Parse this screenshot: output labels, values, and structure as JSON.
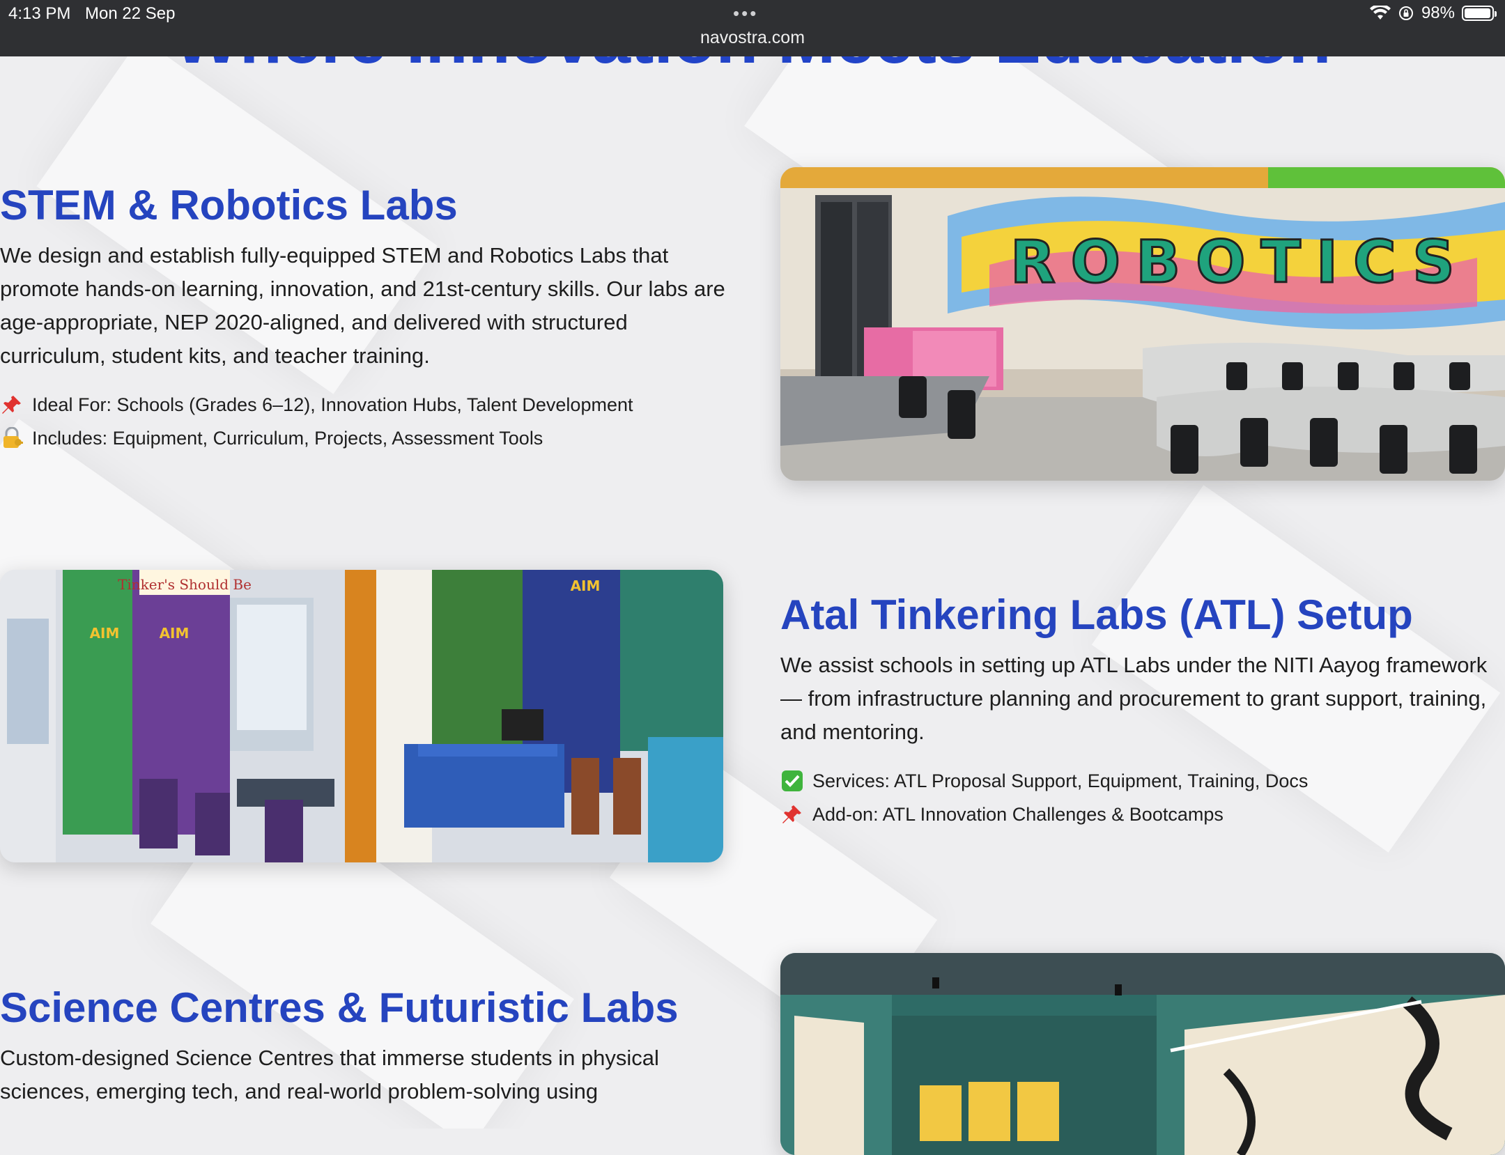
{
  "status": {
    "time": "4:13 PM",
    "date": "Mon 22 Sep",
    "battery": "98%",
    "battery_level": 0.98
  },
  "browser": {
    "url": "navostra.com",
    "menu_dots": "•••"
  },
  "hero": {
    "title": "Where Innovation Meets Education"
  },
  "sections": [
    {
      "title": "STEM & Robotics Labs",
      "description": "We design and establish fully-equipped STEM and Robotics Labs that promote hands-on learning, innovation, and 21st-century skills. Our labs are age-appropriate, NEP 2020-aligned, and delivered with structured curriculum, student kits, and teacher training.",
      "features": [
        {
          "icon": "pushpin-icon",
          "text": "Ideal For: Schools (Grades 6–12), Innovation Hubs, Talent Development"
        },
        {
          "icon": "lock-with-key-icon",
          "text": "Includes: Equipment, Curriculum, Projects, Assessment Tools"
        }
      ],
      "image_label": "ROBOTICS"
    },
    {
      "title": "Atal Tinkering Labs (ATL) Setup",
      "description": "We assist schools in setting up ATL Labs under the NITI Aayog framework — from infrastructure planning and procurement to grant support, training, and mentoring.",
      "features": [
        {
          "icon": "check-mark-icon",
          "text": "Services: ATL Proposal Support, Equipment, Training, Docs"
        },
        {
          "icon": "pushpin-icon",
          "text": "Add-on: ATL Innovation Challenges & Bootcamps"
        }
      ],
      "image_banners": [
        "Tinker's Should Be",
        "AIM",
        "AIM",
        "AIM"
      ]
    },
    {
      "title": "Science Centres & Futuristic Labs",
      "description": "Custom-designed Science Centres that immerse students in physical sciences, emerging tech, and real-world problem-solving using"
    }
  ],
  "colors": {
    "heading": "#2544bf",
    "statusbar": "#2f3033"
  }
}
